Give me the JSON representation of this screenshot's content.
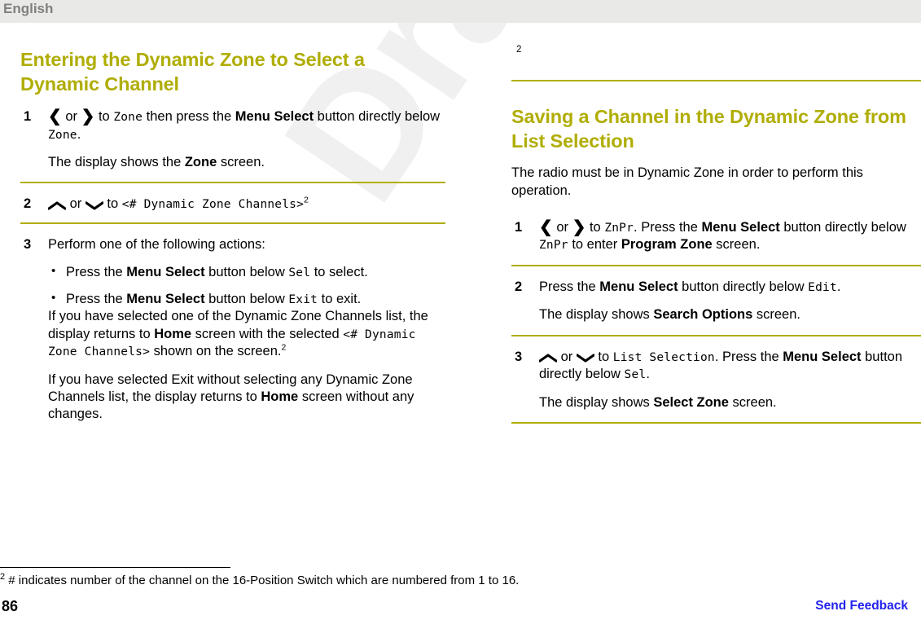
{
  "header": {
    "language_label": "English"
  },
  "watermark": {
    "text": "Draft"
  },
  "left_column": {
    "heading": "Entering the Dynamic Zone to Select a Dynamic Channel",
    "steps": [
      {
        "number": "1",
        "line1_pre": "",
        "chevron_left": "❮",
        "or": " or ",
        "chevron_right": "❯",
        "text_a": " to ",
        "mono_a": "Zone",
        "text_b": " then press the ",
        "bold_a": "Menu Select",
        "text_c": " button directly below ",
        "mono_b": "Zone",
        "text_d": ".",
        "result": "The display shows the Zone screen.",
        "result_pre": "The display shows the ",
        "result_bold": "Zone",
        "result_post": " screen."
      },
      {
        "number": "2",
        "text_a": " or ",
        "text_b": " to ",
        "mono_a": "<# Dynamic Zone Channels>",
        "footnote_ref": "2"
      },
      {
        "number": "3",
        "intro": "Perform one of the following actions:",
        "bullets": [
          {
            "pre": "Press the ",
            "bold": "Menu Select",
            "mid": " button below ",
            "mono": "Sel",
            "post": " to select."
          },
          {
            "pre": "Press the ",
            "bold": "Menu Select",
            "mid": " button below ",
            "mono": "Exit",
            "post": " to exit."
          }
        ],
        "para_a_1": "If you have selected one of the Dynamic Zone Channels list, the display returns to ",
        "para_a_bold": "Home",
        "para_a_2": " screen with the selected ",
        "para_a_mono": "<# Dynamic Zone Channels>",
        "para_a_3": " shown on the screen.",
        "para_a_ref": "2",
        "para_b_1": "If you have selected Exit without selecting any Dynamic Zone Channels list, the display returns to ",
        "para_b_bold": "Home",
        "para_b_2": " screen without any changes."
      }
    ]
  },
  "right_column": {
    "orphan_footnote_marker": "2",
    "heading": "Saving a Channel in the Dynamic Zone from List Selection",
    "intro": "The radio must be in Dynamic Zone in order to perform this operation.",
    "steps": [
      {
        "number": "1",
        "chevron_left": "❮",
        "or": " or ",
        "chevron_right": "❯",
        "text_a": " to ",
        "mono_a": "ZnPr",
        "text_b": ". Press the ",
        "bold_a": "Menu Select",
        "text_c": " button directly below ",
        "mono_b": "ZnPr",
        "text_d": " to enter ",
        "bold_b": "Program Zone",
        "text_e": " screen."
      },
      {
        "number": "2",
        "pre": "Press the ",
        "bold_a": "Menu Select",
        "mid": " button directly below ",
        "mono_a": "Edit",
        "post": ".",
        "result_pre": "The display shows ",
        "result_bold": "Search Options",
        "result_post": " screen."
      },
      {
        "number": "3",
        "text_a": " or ",
        "text_b": " to ",
        "mono_a": "List Selection",
        "text_c": ". Press the ",
        "bold_a": "Menu Select",
        "text_d": " button directly below ",
        "mono_b": "Sel",
        "text_e": ".",
        "result_pre": "The display shows ",
        "result_bold": "Select Zone",
        "result_post": " screen."
      }
    ]
  },
  "footnote": {
    "marker": "2",
    "text": "# indicates number of the channel on the 16-Position Switch which are numbered from 1 to 16."
  },
  "footer": {
    "page_number": "86",
    "send_feedback_label": "Send Feedback"
  },
  "colors": {
    "heading": "#b0ad05",
    "rule": "#b0ad05",
    "header_bar": "#e9e9e7",
    "header_text": "#808080",
    "link": "#2222ee",
    "watermark": "#f0f0f0"
  }
}
